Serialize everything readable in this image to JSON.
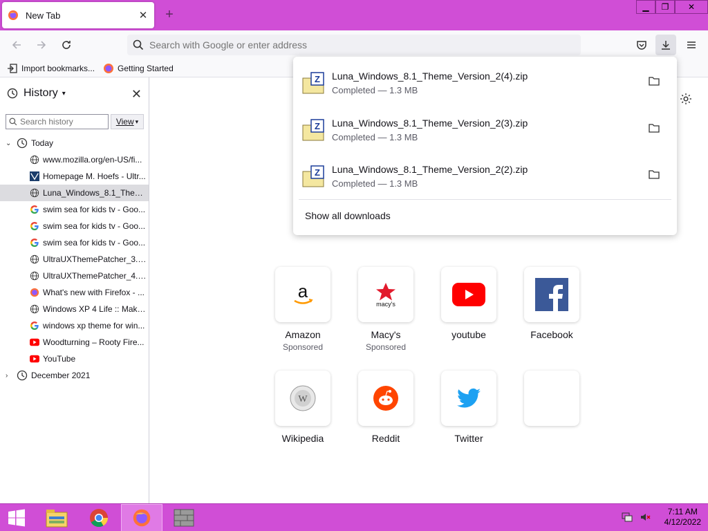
{
  "browser": {
    "tab_title": "New Tab",
    "url_placeholder": "Search with Google or enter address",
    "bookmarks": [
      {
        "label": "Import bookmarks...",
        "icon": "import-icon"
      },
      {
        "label": "Getting Started",
        "icon": "firefox-icon"
      }
    ]
  },
  "sidebar": {
    "title": "History",
    "search_placeholder": "Search history",
    "view_label": "View",
    "groups": [
      {
        "label": "Today",
        "expanded": true,
        "items": [
          {
            "label": "www.mozilla.org/en-US/fi...",
            "icon": "globe-icon"
          },
          {
            "label": "Homepage M. Hoefs - Ultr...",
            "icon": "site-logo-icon"
          },
          {
            "label": "Luna_Windows_8.1_Them...",
            "icon": "globe-icon",
            "selected": true
          },
          {
            "label": "swim sea for kids tv - Goo...",
            "icon": "google-icon"
          },
          {
            "label": "swim sea for kids tv - Goo...",
            "icon": "google-icon"
          },
          {
            "label": "swim sea for kids tv - Goo...",
            "icon": "google-icon"
          },
          {
            "label": "UltraUXThemePatcher_3.0....",
            "icon": "globe-icon"
          },
          {
            "label": "UltraUXThemePatcher_4.3....",
            "icon": "globe-icon"
          },
          {
            "label": "What's new with Firefox - ...",
            "icon": "firefox-icon"
          },
          {
            "label": "Windows XP 4 Life :: Make ...",
            "icon": "globe-icon"
          },
          {
            "label": "windows xp theme for win...",
            "icon": "google-icon"
          },
          {
            "label": "Woodturning – Rooty Fire...",
            "icon": "youtube-icon"
          },
          {
            "label": "YouTube",
            "icon": "youtube-icon"
          }
        ]
      },
      {
        "label": "December 2021",
        "expanded": false,
        "items": []
      }
    ]
  },
  "downloads": {
    "items": [
      {
        "name": "Luna_Windows_8.1_Theme_Version_2(4).zip",
        "status": "Completed — 1.3 MB"
      },
      {
        "name": "Luna_Windows_8.1_Theme_Version_2(3).zip",
        "status": "Completed — 1.3 MB"
      },
      {
        "name": "Luna_Windows_8.1_Theme_Version_2(2).zip",
        "status": "Completed — 1.3 MB"
      }
    ],
    "show_all": "Show all downloads"
  },
  "top_sites": [
    {
      "name": "Amazon",
      "sponsored": "Sponsored",
      "icon": "amazon-icon"
    },
    {
      "name": "Macy's",
      "sponsored": "Sponsored",
      "icon": "macys-icon"
    },
    {
      "name": "youtube",
      "sponsored": "",
      "icon": "youtube-icon"
    },
    {
      "name": "Facebook",
      "sponsored": "",
      "icon": "facebook-icon"
    },
    {
      "name": "Wikipedia",
      "sponsored": "",
      "icon": "wikipedia-icon"
    },
    {
      "name": "Reddit",
      "sponsored": "",
      "icon": "reddit-icon"
    },
    {
      "name": "Twitter",
      "sponsored": "",
      "icon": "twitter-icon"
    },
    {
      "name": "",
      "sponsored": "",
      "icon": "empty-tile"
    }
  ],
  "taskbar": {
    "apps": [
      "explorer-icon",
      "chrome-icon",
      "firefox-icon",
      "app-icon"
    ],
    "time": "7:11 AM",
    "date": "4/12/2022"
  },
  "colors": {
    "accent": "#d04ed6",
    "selected_row": "#dcdce0"
  }
}
